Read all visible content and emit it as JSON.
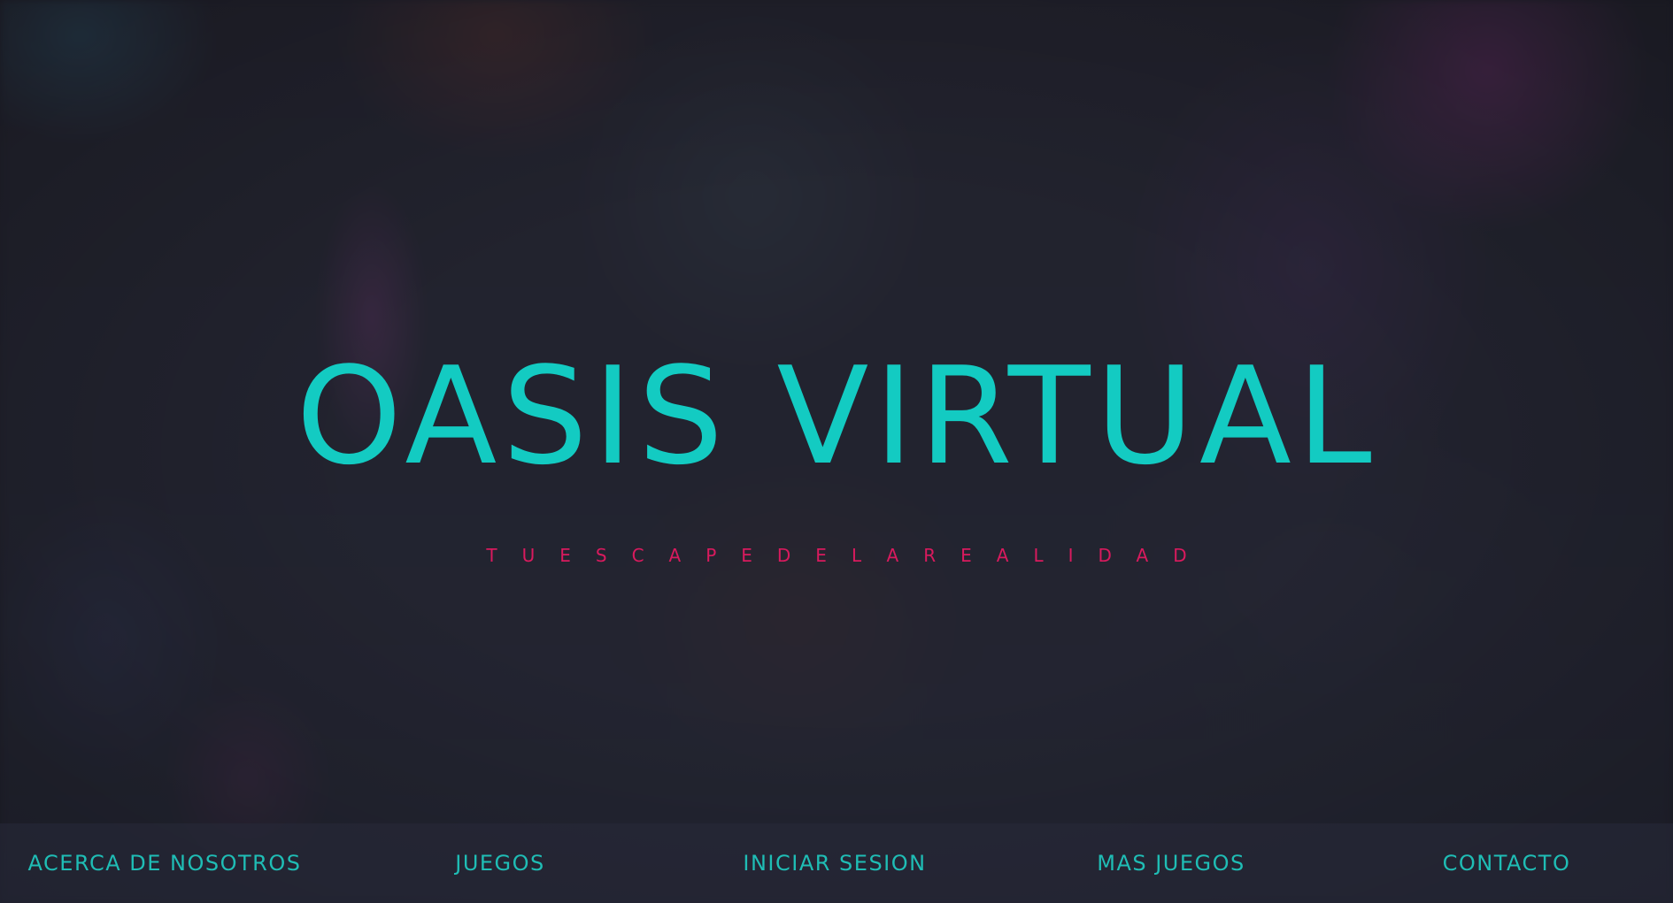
{
  "hero": {
    "title": "OASIS VIRTUAL",
    "subtitle": "TUESCAPEDELAREALIDAD"
  },
  "nav": {
    "items": [
      {
        "label": "ACERCA DE NOSOTROS"
      },
      {
        "label": "JUEGOS"
      },
      {
        "label": "INICIAR SESION"
      },
      {
        "label": "MAS JUEGOS"
      },
      {
        "label": "CONTACTO"
      }
    ]
  },
  "colors": {
    "accent": "#13cbc2",
    "subtitle": "#d91a5e",
    "background": "#20202b"
  }
}
